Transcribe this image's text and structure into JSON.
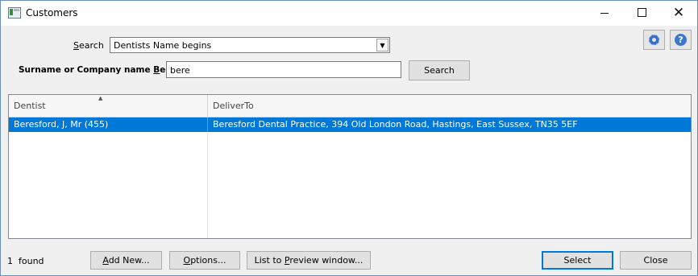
{
  "window": {
    "title": "Customers"
  },
  "search": {
    "label_prefix": "",
    "label_underlined": "S",
    "label_rest": "earch",
    "selected": "Dentists Name begins"
  },
  "begins": {
    "label_prefix": "Surname or Company name ",
    "label_underlined": "B",
    "label_rest": "egins",
    "value": "bere"
  },
  "search_button": "Search",
  "grid": {
    "columns": [
      "Dentist",
      "DeliverTo"
    ],
    "rows": [
      {
        "dentist": "Beresford, J, Mr (455)",
        "deliver_to": "Beresford Dental Practice, 394 Old London Road, Hastings, East Sussex, TN35 5EF",
        "selected": true
      }
    ]
  },
  "footer": {
    "count": "1",
    "count_label": "found",
    "add_new": {
      "u": "A",
      "rest": "dd New..."
    },
    "options": {
      "u": "O",
      "rest": "ptions..."
    },
    "preview": {
      "pre": "List to ",
      "u": "P",
      "rest": "review window..."
    },
    "select": "Select",
    "close": "Close"
  },
  "icons": {
    "settings": "gear-icon",
    "help": "help-icon",
    "selection_color": "#0078d7"
  }
}
